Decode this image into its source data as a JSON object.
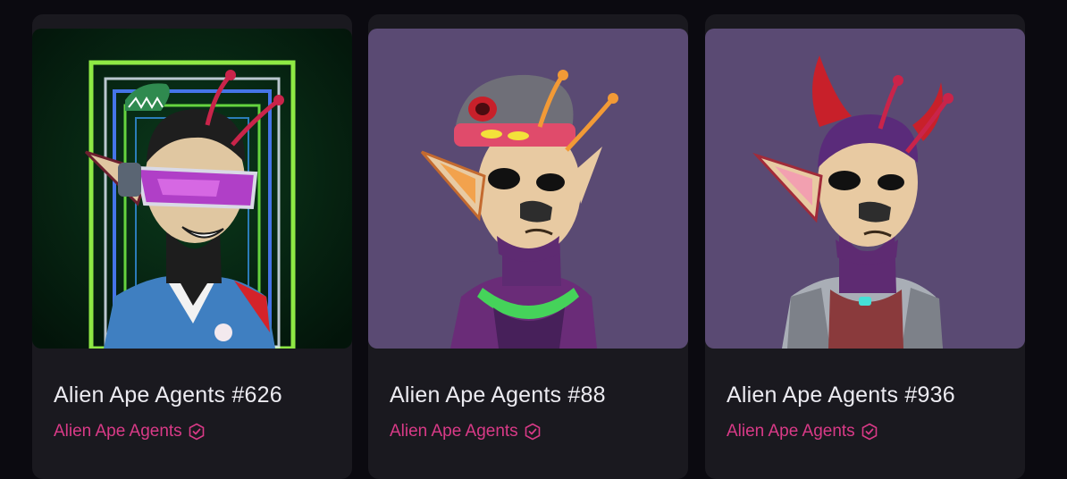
{
  "cards": [
    {
      "title": "Alien Ape Agents #626",
      "collection": "Alien Ape Agents",
      "background_color": "#0d2a16",
      "hat": "green-shark-cap",
      "eyewear": "purple-visor"
    },
    {
      "title": "Alien Ape Agents #88",
      "collection": "Alien Ape Agents",
      "background_color": "#5a4a73",
      "hat": "grey-beanie",
      "eyewear": "none"
    },
    {
      "title": "Alien Ape Agents #936",
      "collection": "Alien Ape Agents",
      "background_color": "#5a4a73",
      "hat": "red-horns",
      "eyewear": "none"
    }
  ],
  "colors": {
    "page_bg": "#0b0a10",
    "card_bg": "#1a191f",
    "title_text": "#ecebf1",
    "accent_pink": "#d93a87"
  },
  "icons": {
    "verified": "verified-badge-icon"
  }
}
